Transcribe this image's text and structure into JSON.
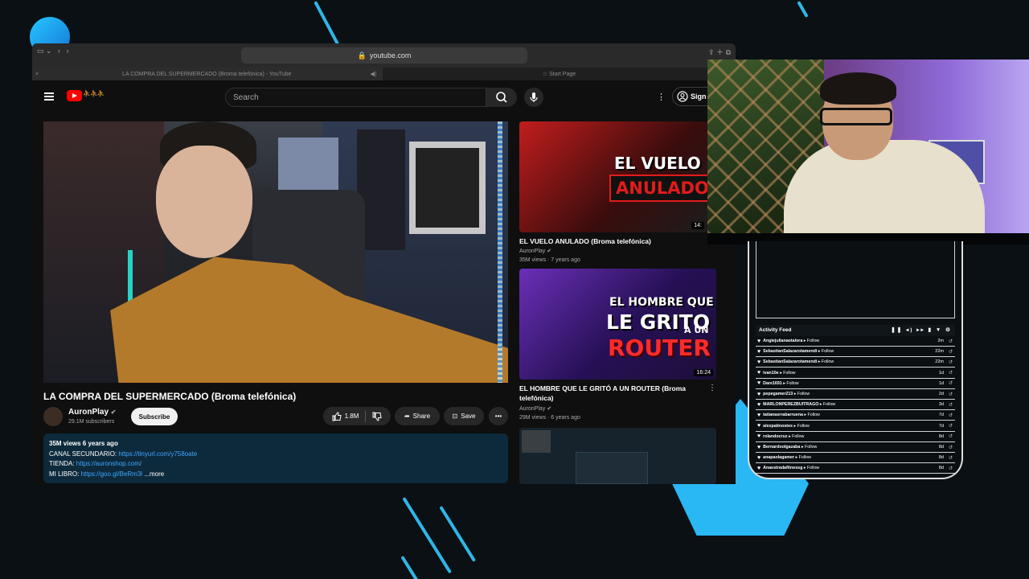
{
  "browser": {
    "url": "youtube.com",
    "active_tab": "LA COMPRA DEL SUPERMERCADO (Broma telefónica) - YouTube",
    "inactive_tab": "Start Page",
    "close_tab_icon": "×"
  },
  "youtube": {
    "search_placeholder": "Search",
    "signin_label": "Sign",
    "video": {
      "title": "LA COMPRA DEL SUPERMERCADO (Broma telefónica)",
      "channel": "AuronPlay",
      "subscribers": "29.1M subscribers",
      "subscribe_label": "Subscribe",
      "likes": "1.8M",
      "share_label": "Share",
      "save_label": "Save"
    },
    "description": {
      "stats": "35M views  6 years ago",
      "line1_label": "CANAL SECUNDARIO:",
      "line1_link": "https://tinyurl.com/y758oate",
      "line2_label": "TIENDA:",
      "line2_link": "https://auronshop.com/",
      "line3_label": "MI LIBRO:",
      "line3_link": "https://goo.gl/BeRm3l",
      "more_label": "...more"
    },
    "recommended": [
      {
        "thumb_text_1": "EL VUELO",
        "thumb_text_2": "ANULADO",
        "duration": "14:",
        "title": "EL VUELO ANULADO (Broma telefónica)",
        "channel": "AuronPlay",
        "meta": "35M views · 7 years ago"
      },
      {
        "thumb_text_1": "EL HOMBRE QUE",
        "thumb_text_2": "LE GRITO",
        "thumb_text_3": "A UN",
        "thumb_text_4": "ROUTER",
        "duration": "16:24",
        "title_line1": "EL HOMBRE QUE LE GRITÓ A UN ROUTER (Broma",
        "title_line2": "telefónica)",
        "channel": "AuronPlay",
        "meta": "29M views · 6 years ago"
      }
    ]
  },
  "activity_feed": {
    "title": "Activity Feed",
    "controls": "❚❚ ◂) ▸▸ ▮ ▼ ⚙",
    "rows": [
      {
        "user": "Angiejulianaotalora",
        "action": "Follow",
        "ago": "2m"
      },
      {
        "user": "SebastianSalazarotamendi",
        "action": "Follow",
        "ago": "22m"
      },
      {
        "user": "SebastianSalazarotamendi",
        "action": "Follow",
        "ago": "22m"
      },
      {
        "user": "ivan10e",
        "action": "Follow",
        "ago": "1d"
      },
      {
        "user": "Dare1691",
        "action": "Follow",
        "ago": "1d"
      },
      {
        "user": "pepegamer213",
        "action": "Follow",
        "ago": "2d"
      },
      {
        "user": "MARLONPEREZBUITRAGO",
        "action": "Follow",
        "ago": "3d"
      },
      {
        "user": "tatianasrrabarruena",
        "action": "Follow",
        "ago": "7d"
      },
      {
        "user": "alexpatinostex",
        "action": "Follow",
        "ago": "7d"
      },
      {
        "user": "rolandocruz",
        "action": "Follow",
        "ago": "8d"
      },
      {
        "user": "Bernardoolgazaba",
        "action": "Follow",
        "ago": "8d"
      },
      {
        "user": "anapaolagamer",
        "action": "Follow",
        "ago": "8d"
      },
      {
        "user": "Anaestradafitnessg",
        "action": "Follow",
        "ago": "8d"
      }
    ]
  },
  "colors": {
    "accent_blue": "#29b8f3",
    "yt_red": "#ff0000",
    "link": "#3ea6ff"
  }
}
